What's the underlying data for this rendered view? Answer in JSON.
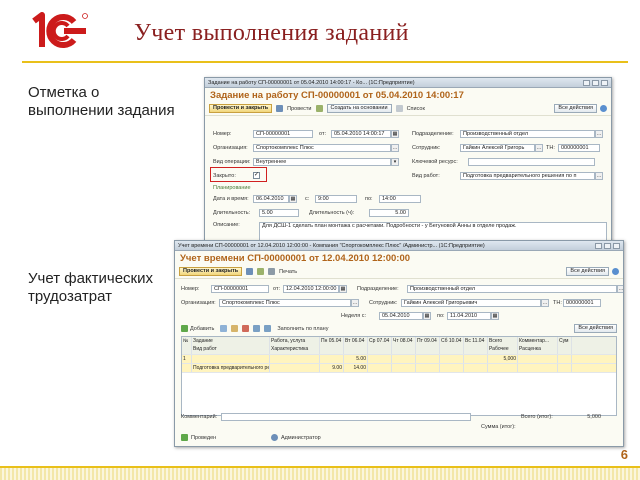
{
  "colors": {
    "brand_red": "#cc1b1b",
    "accent_yellow": "#e9c01a",
    "doc_title": "#b0641a",
    "slide_title": "#8a2020"
  },
  "slide": {
    "logo_text": "1С",
    "title": "Учет выполнения заданий",
    "caption_top": "Отметка о выполнении задания",
    "caption_bottom": "Учет фактических трудозатрат",
    "page_number": "6"
  },
  "task_window": {
    "title_bar": "Задание на работу СП-00000001 от 05.04.2010 14:00:17 - Ко... (1С:Предприятие)",
    "heading": "Задание на работу СП-00000001 от 05.04.2010 14:00:17",
    "toolbar": {
      "save_close": "Провести и закрыть",
      "post": "Провести",
      "create_based": "Создать на основании",
      "list": "Список",
      "actions": "Все действия"
    },
    "fields": {
      "number_label": "Номер:",
      "number": "СП-00000001",
      "date_from_label": "от:",
      "date_from": "05.04.2010 14:00:17",
      "org_label": "Организация:",
      "org": "Спортокомплекс Плюс",
      "op_label": "Вид операции:",
      "op": "Внутреннее",
      "closed_label": "Закрыто:",
      "closed_mark": "✓",
      "dept_label": "Подразделение:",
      "dept": "Производственный отдел",
      "emp_label": "Сотрудник:",
      "emp": "Гайкин Алексей Григорь",
      "tn_label": "ТН:",
      "tn": "000000001",
      "key_res_label": "Ключевой ресурс:",
      "work_type_label": "Вид работ:",
      "work_type": "Подготовка предварительного решения по п",
      "planning_label": "Планирование",
      "datetime_label": "Дата и время:",
      "date": "06.04.2010",
      "from_label": "с:",
      "time_from": "9:00",
      "to_label": "по:",
      "time_to": "14:00",
      "duration_label": "Длительность:",
      "duration": "5.00",
      "duration_h_label": "Длительность (ч):",
      "duration_h": "5.00",
      "desc_label": "Описание:",
      "desc": "Для ДСШ-1 сделать план монтажа с расчетами. Подробности - у Бегуновой Анны в отделе продаж."
    }
  },
  "time_window": {
    "title_bar": "Учет времени СП-00000001 от 12.04.2010 12:00:00 - Компания \"Спортокомплекс Плюс\" /Администр... (1С:Предприятие)",
    "heading": "Учет времени СП-00000001 от 12.04.2010 12:00:00",
    "toolbar": {
      "save_close": "Провести и закрыть",
      "print": "Печать",
      "actions": "Все действия"
    },
    "fields": {
      "number_label": "Номер:",
      "number": "СП-00000001",
      "date_from_label": "от:",
      "date_from": "12.04.2010 12:00:00",
      "dept_label": "Подразделение:",
      "dept": "Производственный отдел",
      "org_label": "Организация:",
      "org": "Спортокомплекс Плюс",
      "emp_label": "Сотрудник:",
      "emp": "Гайкин Алексей Григорьевич",
      "tn_label": "ТН:",
      "tn": "000000001",
      "week_label": "Неделя с:",
      "week_from": "05.04.2010",
      "week_to_label": "по:",
      "week_to": "11.04.2010"
    },
    "table_toolbar": {
      "add": "Добавить",
      "fill": "Заполнить по плану",
      "actions": "Все действия"
    },
    "columns": [
      [
        "№",
        ""
      ],
      [
        "Задание",
        "Вид работ"
      ],
      [
        "Работа, услуга",
        "Характеристика"
      ],
      [
        "Пн 05.04",
        ""
      ],
      [
        "Вт 06.04",
        ""
      ],
      [
        "Ср 07.04",
        ""
      ],
      [
        "Чт 08.04",
        ""
      ],
      [
        "Пт 09.04",
        ""
      ],
      [
        "Сб 10.04",
        ""
      ],
      [
        "Вс 11.04",
        ""
      ],
      [
        "Всего",
        "Рабочее"
      ],
      [
        "Комментар...",
        "Расценка"
      ],
      [
        "Сум",
        ""
      ]
    ],
    "rows": [
      [
        "1",
        "",
        "",
        "",
        "5.00",
        "",
        "",
        "",
        "",
        "",
        "5,000",
        "",
        ""
      ],
      [
        "",
        "Подготовка предварительного решени...",
        "",
        "9.00",
        "14.00",
        "",
        "",
        "",
        "",
        "",
        "",
        "",
        ""
      ]
    ],
    "footer": {
      "comment_label": "Комментарий:",
      "total_label": "Всего (итог):",
      "total": "5,000",
      "sum_label": "Сумма (итог):",
      "posted": "Проведен",
      "author": "Администратор"
    }
  }
}
